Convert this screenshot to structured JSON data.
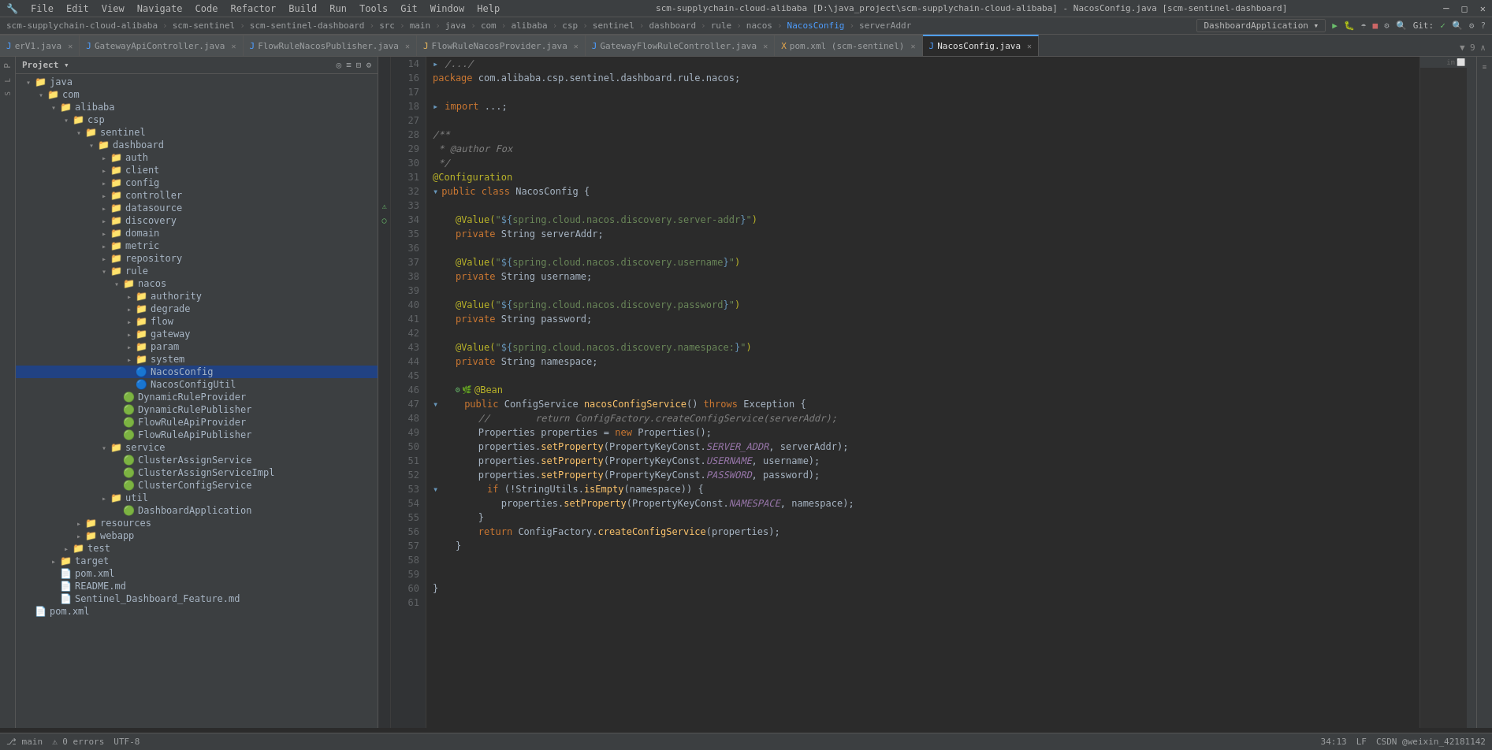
{
  "menubar": {
    "items": [
      "File",
      "Edit",
      "View",
      "Navigate",
      "Code",
      "Refactor",
      "Build",
      "Run",
      "Tools",
      "Git",
      "Window",
      "Help"
    ]
  },
  "title_bar": {
    "path": "scm-supplychain-cloud-alibaba [D:\\java_project\\scm-supplychain-cloud-alibaba] - NacosConfig.java [scm-sentinel-dashboard]"
  },
  "breadcrumb": {
    "items": [
      "scm-supplychain-cloud-alibaba",
      "scm-sentinel",
      "scm-sentinel-dashboard",
      "src",
      "main",
      "java",
      "com",
      "alibaba",
      "csp",
      "sentinel",
      "dashboard",
      "rule",
      "nacos",
      "NacosConfig",
      "serverAddr"
    ]
  },
  "tabs": [
    {
      "name": "erV1.java",
      "active": false,
      "modified": false
    },
    {
      "name": "GatewayApiController.java",
      "active": false,
      "modified": false
    },
    {
      "name": "FlowRuleNacosPublisher.java",
      "active": false,
      "modified": false
    },
    {
      "name": "FlowRuleNacosProvider.java",
      "active": false,
      "modified": false
    },
    {
      "name": "GatewayFlowRuleController.java",
      "active": false,
      "modified": false
    },
    {
      "name": "pom.xml (scm-sentinel)",
      "active": false,
      "modified": false
    },
    {
      "name": "NacosConfig.java",
      "active": true,
      "modified": false
    }
  ],
  "sidebar": {
    "title": "Project",
    "tree": [
      {
        "level": 1,
        "type": "folder",
        "name": "java",
        "expanded": true
      },
      {
        "level": 2,
        "type": "folder",
        "name": "com",
        "expanded": true
      },
      {
        "level": 3,
        "type": "folder",
        "name": "alibaba",
        "expanded": true
      },
      {
        "level": 4,
        "type": "folder",
        "name": "csp",
        "expanded": true
      },
      {
        "level": 5,
        "type": "folder",
        "name": "sentinel",
        "expanded": true
      },
      {
        "level": 6,
        "type": "folder",
        "name": "dashboard",
        "expanded": true
      },
      {
        "level": 7,
        "type": "folder",
        "name": "auth",
        "expanded": false
      },
      {
        "level": 7,
        "type": "folder",
        "name": "client",
        "expanded": false
      },
      {
        "level": 7,
        "type": "folder",
        "name": "config",
        "expanded": false
      },
      {
        "level": 7,
        "type": "folder",
        "name": "controller",
        "expanded": false
      },
      {
        "level": 7,
        "type": "folder",
        "name": "datasource",
        "expanded": false
      },
      {
        "level": 7,
        "type": "folder",
        "name": "discovery",
        "expanded": false
      },
      {
        "level": 7,
        "type": "folder",
        "name": "domain",
        "expanded": false
      },
      {
        "level": 7,
        "type": "folder",
        "name": "metric",
        "expanded": false
      },
      {
        "level": 7,
        "type": "folder",
        "name": "repository",
        "expanded": false
      },
      {
        "level": 7,
        "type": "folder",
        "name": "rule",
        "expanded": true
      },
      {
        "level": 8,
        "type": "folder",
        "name": "nacos",
        "expanded": true
      },
      {
        "level": 9,
        "type": "folder",
        "name": "authority",
        "expanded": false
      },
      {
        "level": 9,
        "type": "folder",
        "name": "degrade",
        "expanded": false
      },
      {
        "level": 9,
        "type": "folder",
        "name": "flow",
        "expanded": false
      },
      {
        "level": 9,
        "type": "folder",
        "name": "gateway",
        "expanded": false
      },
      {
        "level": 9,
        "type": "folder",
        "name": "param",
        "expanded": false
      },
      {
        "level": 9,
        "type": "folder",
        "name": "system",
        "expanded": false
      },
      {
        "level": 9,
        "type": "file-java-blue",
        "name": "NacosConfig",
        "selected": true
      },
      {
        "level": 9,
        "type": "file-java-blue",
        "name": "NacosConfigUtil"
      },
      {
        "level": 8,
        "type": "file-java-green",
        "name": "DynamicRuleProvider"
      },
      {
        "level": 8,
        "type": "file-java-green",
        "name": "DynamicRulePublisher"
      },
      {
        "level": 8,
        "type": "file-java-green",
        "name": "FlowRuleApiProvider"
      },
      {
        "level": 8,
        "type": "file-java-green",
        "name": "FlowRuleApiPublisher"
      },
      {
        "level": 7,
        "type": "folder",
        "name": "service",
        "expanded": true
      },
      {
        "level": 8,
        "type": "file-java-green",
        "name": "ClusterAssignService"
      },
      {
        "level": 8,
        "type": "file-java-green",
        "name": "ClusterAssignServiceImpl"
      },
      {
        "level": 8,
        "type": "file-java-green",
        "name": "ClusterConfigService"
      },
      {
        "level": 7,
        "type": "folder",
        "name": "util",
        "expanded": false
      },
      {
        "level": 8,
        "type": "file-java-green",
        "name": "DashboardApplication"
      },
      {
        "level": 5,
        "type": "folder",
        "name": "resources",
        "expanded": false
      },
      {
        "level": 5,
        "type": "folder",
        "name": "webapp",
        "expanded": false
      },
      {
        "level": 4,
        "type": "folder",
        "name": "test",
        "expanded": false
      },
      {
        "level": 3,
        "type": "folder-orange",
        "name": "target",
        "expanded": false
      },
      {
        "level": 2,
        "type": "file-xml",
        "name": "pom.xml"
      },
      {
        "level": 2,
        "type": "file-md",
        "name": "README.md"
      },
      {
        "level": 2,
        "type": "file-md",
        "name": "Sentinel_Dashboard_Feature.md"
      },
      {
        "level": 1,
        "type": "file-xml",
        "name": "pom.xml"
      }
    ]
  },
  "code": {
    "filename": "NacosConfig.java",
    "lines": [
      {
        "num": 14,
        "content": "/.../",
        "type": "comment"
      },
      {
        "num": 16,
        "content": "package com.alibaba.csp.sentinel.dashboard.rule.nacos;",
        "type": "normal"
      },
      {
        "num": 17,
        "content": "",
        "type": "normal"
      },
      {
        "num": 18,
        "content": "import ...;",
        "type": "import"
      },
      {
        "num": 27,
        "content": "",
        "type": "normal"
      },
      {
        "num": 28,
        "content": "/**",
        "type": "comment"
      },
      {
        "num": 29,
        "content": " * @author Fox",
        "type": "comment"
      },
      {
        "num": 30,
        "content": " */",
        "type": "comment"
      },
      {
        "num": 31,
        "content": "@Configuration",
        "type": "annotation"
      },
      {
        "num": 32,
        "content": "public class NacosConfig {",
        "type": "class"
      },
      {
        "num": 33,
        "content": "",
        "type": "normal"
      },
      {
        "num": 34,
        "content": "    @Value(\"${spring.cloud.nacos.discovery.server-addr}\")",
        "type": "annotation"
      },
      {
        "num": 35,
        "content": "    private String serverAddr;",
        "type": "field"
      },
      {
        "num": 36,
        "content": "",
        "type": "normal"
      },
      {
        "num": 37,
        "content": "    @Value(\"${spring.cloud.nacos.discovery.username}\")",
        "type": "annotation"
      },
      {
        "num": 38,
        "content": "    private String username;",
        "type": "field"
      },
      {
        "num": 39,
        "content": "",
        "type": "normal"
      },
      {
        "num": 40,
        "content": "    @Value(\"${spring.cloud.nacos.discovery.password}\")",
        "type": "annotation"
      },
      {
        "num": 41,
        "content": "    private String password;",
        "type": "field"
      },
      {
        "num": 42,
        "content": "",
        "type": "normal"
      },
      {
        "num": 43,
        "content": "    @Value(\"${spring.cloud.nacos.discovery.namespace:}\")",
        "type": "annotation"
      },
      {
        "num": 44,
        "content": "    private String namespace;",
        "type": "field"
      },
      {
        "num": 45,
        "content": "",
        "type": "normal"
      },
      {
        "num": 46,
        "content": "    @Bean",
        "type": "annotation"
      },
      {
        "num": 47,
        "content": "    public ConfigService nacosConfigService() throws Exception {",
        "type": "method"
      },
      {
        "num": 48,
        "content": "//        return ConfigFactory.createConfigService(serverAddr);",
        "type": "comment"
      },
      {
        "num": 49,
        "content": "        Properties properties = new Properties();",
        "type": "normal"
      },
      {
        "num": 50,
        "content": "        properties.setProperty(PropertyKeyConst.SERVER_ADDR, serverAddr);",
        "type": "normal"
      },
      {
        "num": 51,
        "content": "        properties.setProperty(PropertyKeyConst.USERNAME, username);",
        "type": "normal"
      },
      {
        "num": 52,
        "content": "        properties.setProperty(PropertyKeyConst.PASSWORD, password);",
        "type": "normal"
      },
      {
        "num": 53,
        "content": "        if (!StringUtils.isEmpty(namespace)) {",
        "type": "normal"
      },
      {
        "num": 54,
        "content": "            properties.setProperty(PropertyKeyConst.NAMESPACE, namespace);",
        "type": "normal"
      },
      {
        "num": 55,
        "content": "        }",
        "type": "normal"
      },
      {
        "num": 56,
        "content": "        return ConfigFactory.createConfigService(properties);",
        "type": "normal"
      },
      {
        "num": 57,
        "content": "    }",
        "type": "normal"
      },
      {
        "num": 58,
        "content": "",
        "type": "normal"
      },
      {
        "num": 59,
        "content": "",
        "type": "normal"
      },
      {
        "num": 60,
        "content": "}",
        "type": "normal"
      },
      {
        "num": 61,
        "content": "",
        "type": "normal"
      }
    ]
  },
  "status_bar": {
    "right_text": "CSDN @weixin_42181142",
    "git_info": "Git: ✓"
  }
}
